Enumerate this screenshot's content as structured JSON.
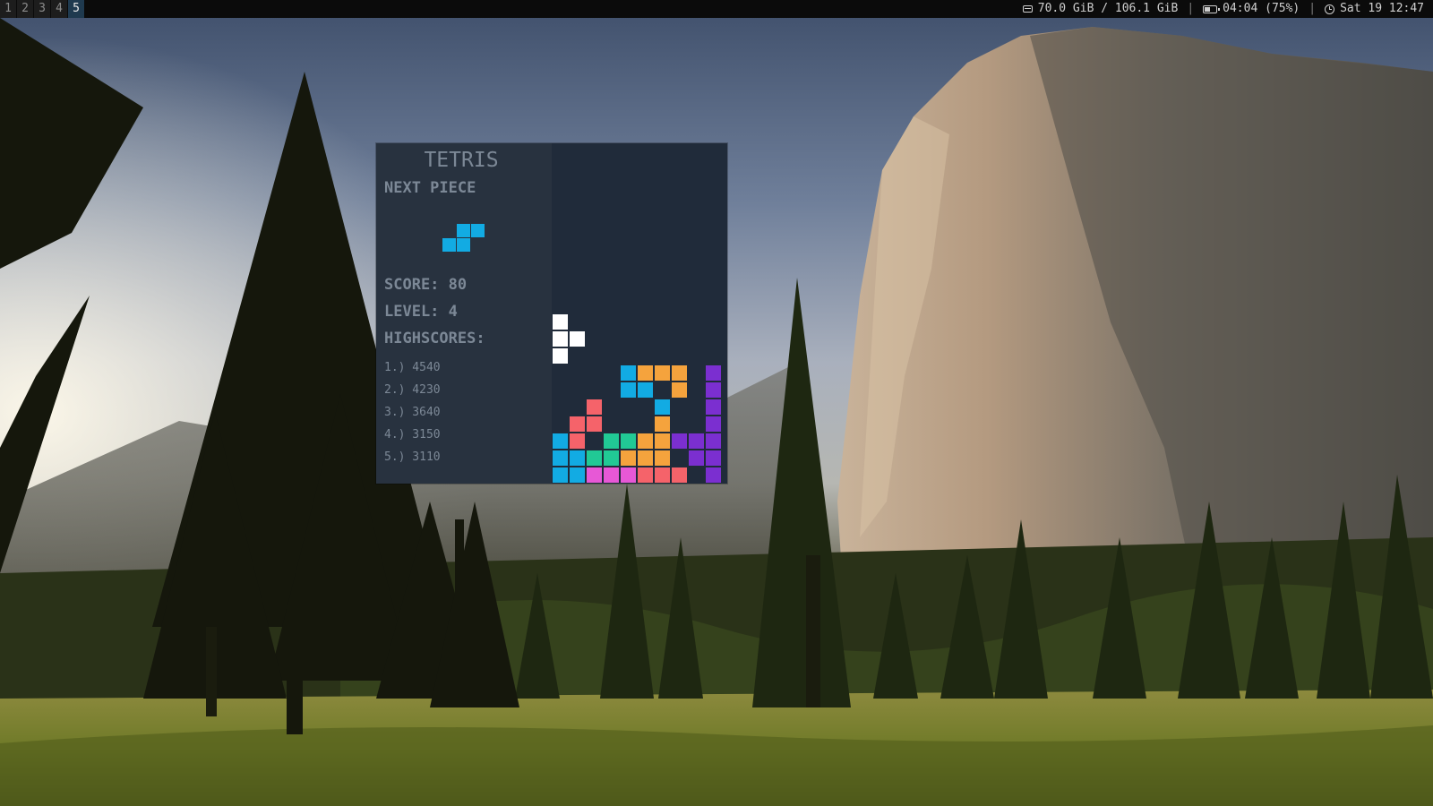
{
  "topbar": {
    "workspaces": [
      "1",
      "2",
      "3",
      "4",
      "5"
    ],
    "active_workspace": "5",
    "disk": "70.0 GiB / 106.1 GiB",
    "separator": "|",
    "battery": "04:04 (75%)",
    "clock": "Sat 19 12:47",
    "icons": {
      "disk": "disk-icon",
      "battery": "battery-icon",
      "clock": "clock-icon"
    }
  },
  "tetris": {
    "title": "TETRIS",
    "next_piece_label": "NEXT PIECE",
    "score_label": "SCORE: 80",
    "level_label": "LEVEL: 4",
    "highscores_label": "HIGHSCORES:",
    "highscores": [
      "1.) 4540",
      "2.) 4230",
      "3.) 3640",
      "4.) 3150",
      "5.) 3110"
    ],
    "next_piece": {
      "shape": "S",
      "color": "#12abe3"
    },
    "active_piece": {
      "shape": "T",
      "color": "#ffffff"
    },
    "colors": {
      "cyan": "#12abe3",
      "orange": "#f5a33d",
      "purple": "#7b2fd0",
      "red": "#f5636a",
      "green": "#21c995",
      "pink": "#e758d6",
      "white": "#ffffff"
    },
    "board_cols": 10,
    "board_rows": 20,
    "board": [
      "..........",
      "..........",
      "..........",
      "..........",
      "..........",
      "..........",
      "..........",
      "..........",
      "..........",
      "..........",
      "W.........",
      "WW........",
      "W.........",
      "....CFFF.U",
      "....CC.F.U",
      "..R...C..U",
      ".RR...F..U",
      "CR.GGOFUUU",
      "CCGGOOO.UU",
      "CCPPPRRR.U"
    ]
  }
}
